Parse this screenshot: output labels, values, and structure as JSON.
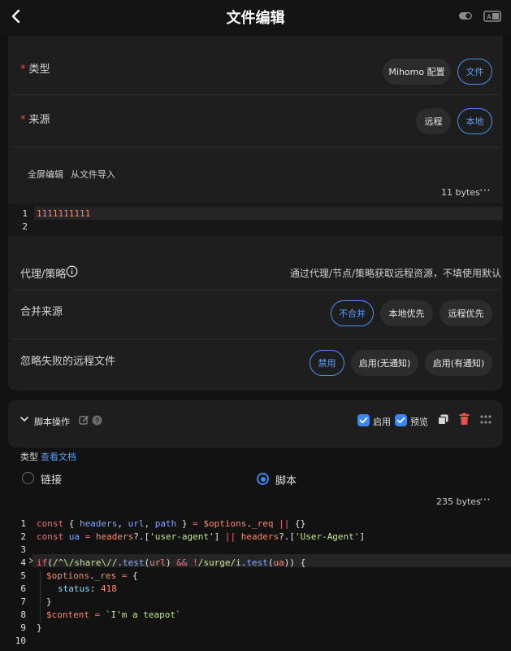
{
  "header": {
    "title": "文件编辑"
  },
  "form": {
    "type": {
      "label": "类型",
      "options": [
        "Mihomo 配置",
        "文件"
      ],
      "selected": "文件"
    },
    "source": {
      "label": "来源",
      "options": [
        "远程",
        "本地"
      ],
      "selected": "本地"
    },
    "editor_actions": [
      "全屏编辑",
      "从文件导入"
    ],
    "file_bytes": "11 bytes",
    "file_lines": [
      "1111111111",
      ""
    ],
    "proxy": {
      "label": "代理/策略",
      "placeholder": "通过代理/节点/策略获取远程资源，不填使用默认"
    },
    "merge": {
      "label": "合并来源",
      "options": [
        "不合并",
        "本地优先",
        "远程优先"
      ],
      "selected": "不合并"
    },
    "ignore_failed": {
      "label": "忽略失败的远程文件",
      "options": [
        "禁用",
        "启用(无通知)",
        "启用(有通知)"
      ],
      "selected": "禁用"
    }
  },
  "script_section": {
    "title": "脚本操作",
    "enable_label": "启用",
    "preview_label": "预览",
    "type_label": "类型",
    "doc_link": "查看文档",
    "radio_link": "链接",
    "radio_script": "脚本",
    "selected": "脚本",
    "bytes": "235 bytes"
  },
  "code": {
    "line_numbers": [
      "1",
      "2",
      "3",
      "4",
      "5",
      "6",
      "7",
      "8",
      "9",
      "10"
    ],
    "active_line": 4
  },
  "colors": {
    "accent": "#3d86f2",
    "danger": "#e8514a",
    "background": "#121212",
    "card": "#1e1e1e"
  }
}
